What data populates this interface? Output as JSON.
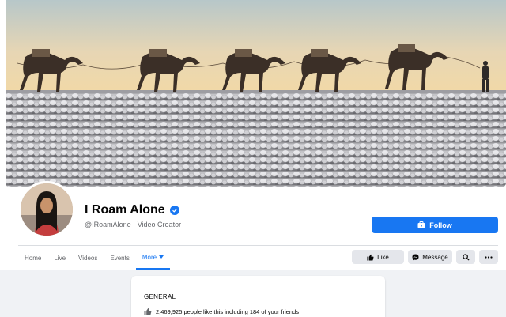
{
  "page": {
    "name": "I Roam Alone",
    "handle": "@IRoamAlone",
    "category": "Video Creator",
    "separator": "·"
  },
  "buttons": {
    "follow": "Follow",
    "like": "Like",
    "message": "Message"
  },
  "tabs": [
    {
      "label": "Home"
    },
    {
      "label": "Live"
    },
    {
      "label": "Videos"
    },
    {
      "label": "Events"
    },
    {
      "label": "More",
      "active": true
    }
  ],
  "general": {
    "title": "GENERAL",
    "likes_text": "2,469,925 people like this including 184 of your friends"
  },
  "colors": {
    "accent": "#1877f2",
    "button_gray": "#e4e6eb",
    "background": "#f0f2f5"
  },
  "icons": [
    "verified-badge-icon",
    "follow-icon",
    "thumbs-up-icon",
    "messenger-icon",
    "search-icon",
    "more-dots-icon"
  ]
}
